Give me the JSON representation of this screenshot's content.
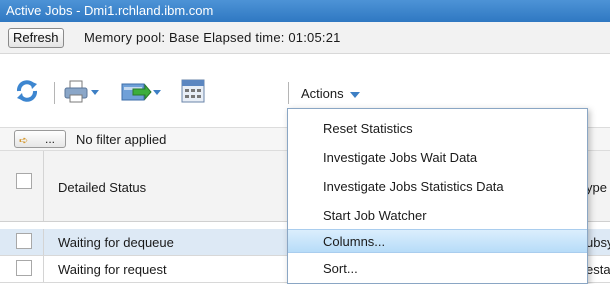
{
  "window": {
    "title": "Active Jobs - Dmi1.rchland.ibm.com"
  },
  "infobar": {
    "refresh_label": "Refresh",
    "status_text": "Memory pool: Base Elapsed time: 01:05:21"
  },
  "toolbar": {
    "actions_label": "Actions",
    "icons": [
      "refresh-icon",
      "print-icon",
      "export-icon",
      "calculator-icon"
    ]
  },
  "filter": {
    "button_label": "...",
    "label": "No filter applied"
  },
  "table": {
    "headers": [
      "Detailed Status",
      "ype"
    ],
    "rows": [
      {
        "status": "Waiting for dequeue",
        "type": "ubsy"
      },
      {
        "status": "Waiting for request",
        "type": "esta"
      }
    ]
  },
  "actions_menu": {
    "items": [
      "Reset Statistics",
      "Investigate Jobs Wait Data",
      "Investigate Jobs Statistics Data",
      "Start Job Watcher",
      "Columns...",
      "Sort..."
    ],
    "highlighted": "Columns..."
  },
  "colors": {
    "titlebar": "#3a84cc",
    "selected_row": "#dde9f5",
    "menu_highlight": "#c6e4fa"
  }
}
